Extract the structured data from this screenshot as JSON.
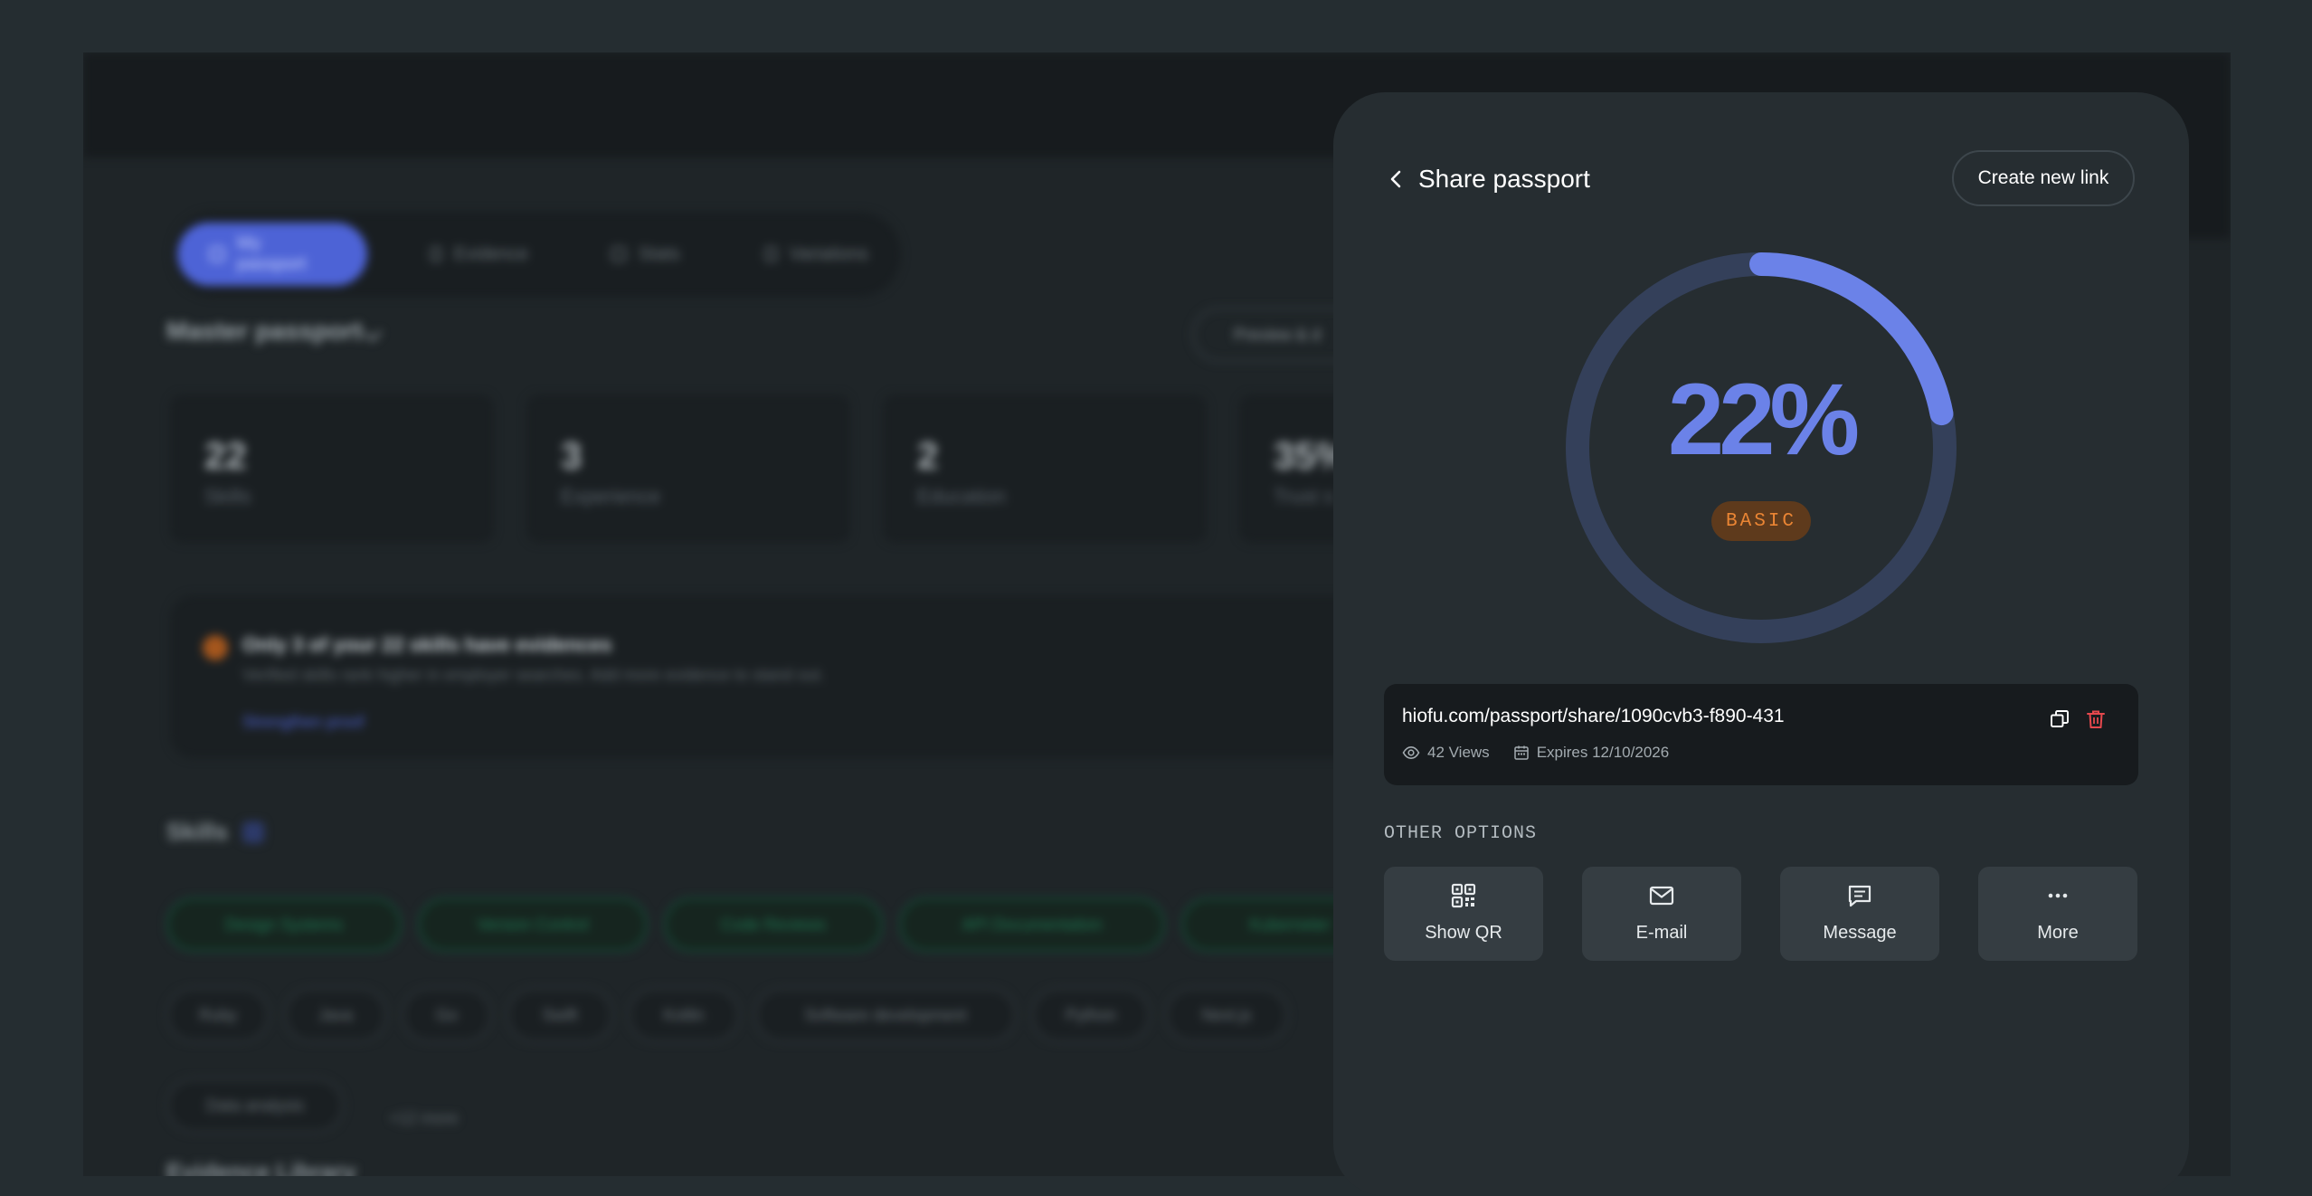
{
  "background_app": {
    "tabs": [
      {
        "label": "My passport",
        "active": true
      },
      {
        "label": "Evidence",
        "active": false
      },
      {
        "label": "Stats",
        "active": false
      },
      {
        "label": "Variations",
        "active": false
      }
    ],
    "passport_selector": "Master passport",
    "preview_button": "Preview & d",
    "stats": [
      {
        "value": "22",
        "label": "Skills"
      },
      {
        "value": "3",
        "label": "Experience"
      },
      {
        "value": "2",
        "label": "Education"
      },
      {
        "value": "35%",
        "label": "Trust s"
      }
    ],
    "alert": {
      "title": "Only 3 of your 22 skills have evidences",
      "subtitle": "Verified skills rank higher in employer searches. Add more evidence to stand out.",
      "link": "Strengthen proof"
    },
    "skills_title": "Skills",
    "verified_skills": [
      "Design Systems",
      "Version Control",
      "Code Reviews",
      "API Documentation",
      "Kuberneter"
    ],
    "skills": [
      "Ruby",
      "Java",
      "Go",
      "Swift",
      "Kotlin",
      "Software development",
      "Python",
      "Next.js"
    ],
    "extra_skills": [
      "Data analysis"
    ],
    "more_skills": "+12 more",
    "evidence_library_title": "Evidence Library"
  },
  "share_panel": {
    "title": "Share passport",
    "create_button": "Create new link",
    "score": {
      "value": 22,
      "display": "22%",
      "level": "BASIC"
    },
    "link": {
      "url": "hiofu.com/passport/share/1090cvb3-f890-431",
      "views": "42 Views",
      "expires": "Expires 12/10/2026"
    },
    "other_options_label": "OTHER OPTIONS",
    "options": [
      {
        "label": "Show QR",
        "icon": "qr-code-icon"
      },
      {
        "label": "E-mail",
        "icon": "mail-icon"
      },
      {
        "label": "Message",
        "icon": "message-icon"
      },
      {
        "label": "More",
        "icon": "more-dots-icon"
      }
    ]
  },
  "colors": {
    "accent": "#6b82e8",
    "ring_track": "#34405a",
    "badge_text": "#ea8534",
    "badge_bg": "#5e3a1c",
    "delete": "#e5484d",
    "panel_bg": "#262d31"
  }
}
